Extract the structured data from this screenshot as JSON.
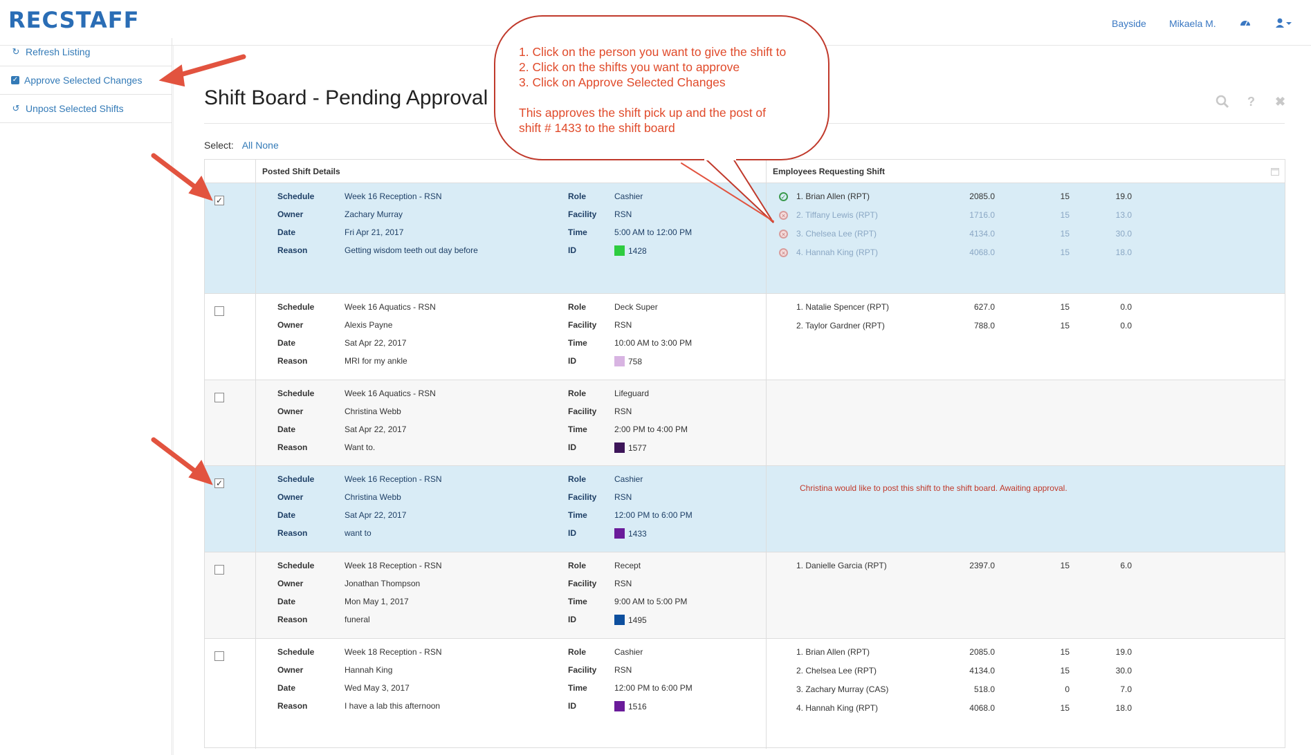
{
  "app": {
    "logo": "RECSTAFF"
  },
  "topnav": {
    "location": "Bayside",
    "user": "Mikaela M.",
    "dashboard_icon": "dashboard-icon",
    "user_icon": "user-icon"
  },
  "sidebar": {
    "items": [
      {
        "label": "Refresh Listing",
        "icon": "refresh-icon"
      },
      {
        "label": "Approve Selected Changes",
        "icon": "checkbox-icon"
      },
      {
        "label": "Unpost Selected Shifts",
        "icon": "undo-icon"
      }
    ]
  },
  "page": {
    "title": "Shift Board - Pending Approval"
  },
  "select": {
    "label": "Select:",
    "all": "All",
    "none": "None"
  },
  "table": {
    "col_posted": "Posted Shift Details",
    "col_employees": "Employees Requesting Shift",
    "rows": [
      {
        "checked": true,
        "schedule": "Week 16 Reception - RSN",
        "owner": "Zachary Murray",
        "date": "Fri Apr 21, 2017",
        "reason": "Getting wisdom teeth out day before",
        "role": "Cashier",
        "facility": "RSN",
        "time": "5:00 AM to 12:00 PM",
        "id": "1428",
        "id_color": "#2ecc40",
        "employees": [
          {
            "name": "1. Brian Allen (RPT)",
            "a": "2085.0",
            "b": "15",
            "c": "19.0",
            "status": "approved"
          },
          {
            "name": "2. Tiffany Lewis (RPT)",
            "a": "1716.0",
            "b": "15",
            "c": "13.0",
            "status": "declined"
          },
          {
            "name": "3. Chelsea Lee (RPT)",
            "a": "4134.0",
            "b": "15",
            "c": "30.0",
            "status": "declined"
          },
          {
            "name": "4. Hannah King (RPT)",
            "a": "4068.0",
            "b": "15",
            "c": "18.0",
            "status": "declined"
          }
        ]
      },
      {
        "checked": false,
        "schedule": "Week 16 Aquatics - RSN",
        "owner": "Alexis Payne",
        "date": "Sat Apr 22, 2017",
        "reason": "MRI for my ankle",
        "role": "Deck Super",
        "facility": "RSN",
        "time": "10:00 AM to 3:00 PM",
        "id": "758",
        "id_color": "#d8b4e2",
        "employees": [
          {
            "name": "1. Natalie Spencer (RPT)",
            "a": "627.0",
            "b": "15",
            "c": "0.0"
          },
          {
            "name": "2. Taylor Gardner (RPT)",
            "a": "788.0",
            "b": "15",
            "c": "0.0"
          }
        ]
      },
      {
        "checked": false,
        "schedule": "Week 16 Aquatics - RSN",
        "owner": "Christina Webb",
        "date": "Sat Apr 22, 2017",
        "reason": "Want to.",
        "role": "Lifeguard",
        "facility": "RSN",
        "time": "2:00 PM to 4:00 PM",
        "id": "1577",
        "id_color": "#3d1559",
        "employees": []
      },
      {
        "checked": true,
        "schedule": "Week 16 Reception - RSN",
        "owner": "Christina Webb",
        "date": "Sat Apr 22, 2017",
        "reason": "want to",
        "role": "Cashier",
        "facility": "RSN",
        "time": "12:00 PM to 6:00 PM",
        "id": "1433",
        "id_color": "#6a1b9a",
        "note": "Christina would like to post this shift to the shift board. Awaiting approval.",
        "employees": []
      },
      {
        "checked": false,
        "schedule": "Week 18 Reception - RSN",
        "owner": "Jonathan Thompson",
        "date": "Mon May 1, 2017",
        "reason": "funeral",
        "role": "Recept",
        "facility": "RSN",
        "time": "9:00 AM to 5:00 PM",
        "id": "1495",
        "id_color": "#0d4f9e",
        "employees": [
          {
            "name": "1. Danielle Garcia (RPT)",
            "a": "2397.0",
            "b": "15",
            "c": "6.0"
          }
        ]
      },
      {
        "checked": false,
        "schedule": "Week 18 Reception - RSN",
        "owner": "Hannah King",
        "date": "Wed May 3, 2017",
        "reason": "I have a lab this afternoon",
        "role": "Cashier",
        "facility": "RSN",
        "time": "12:00 PM to 6:00 PM",
        "id": "1516",
        "id_color": "#6a1b9a",
        "employees": [
          {
            "name": "1. Brian Allen (RPT)",
            "a": "2085.0",
            "b": "15",
            "c": "19.0"
          },
          {
            "name": "2. Chelsea Lee (RPT)",
            "a": "4134.0",
            "b": "15",
            "c": "30.0"
          },
          {
            "name": "3. Zachary Murray (CAS)",
            "a": "518.0",
            "b": "0",
            "c": "7.0"
          },
          {
            "name": "4. Hannah King (RPT)",
            "a": "4068.0",
            "b": "15",
            "c": "18.0"
          }
        ]
      }
    ]
  },
  "labels": {
    "schedule": "Schedule",
    "owner": "Owner",
    "date": "Date",
    "reason": "Reason",
    "role": "Role",
    "facility": "Facility",
    "time": "Time",
    "id": "ID"
  },
  "callout": {
    "lines": [
      "1. Click on the person you want to give the shift to",
      "2. Click on the shifts you want to approve",
      "3. Click on Approve Selected Changes"
    ],
    "lines2": [
      "This approves the shift pick up and the post of",
      "shift # 1433 to the shift board"
    ]
  },
  "colors": {
    "accent": "#337ab7",
    "selected_row": "#d9ecf6",
    "annotation": "#e04a2a"
  }
}
